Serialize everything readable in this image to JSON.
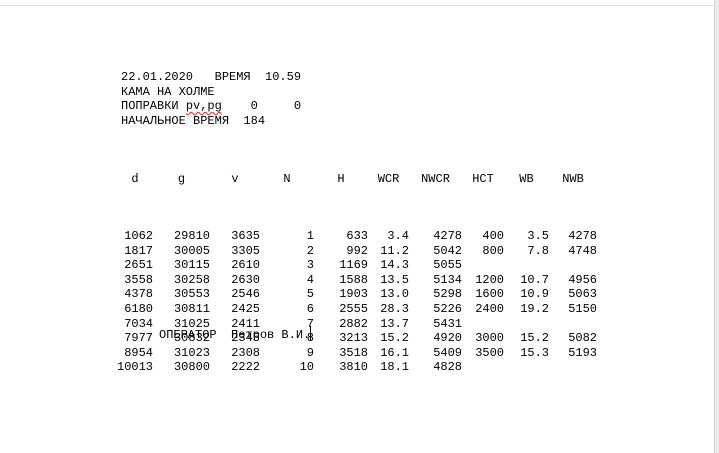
{
  "header": {
    "line1": "22.01.2020   ВРЕМЯ  10.59",
    "line2": "КАМА НА ХОЛМЕ",
    "line3_label": "ПОПРАВКИ ",
    "line3_flagged": "pv,pg",
    "line3_values": "    0     0",
    "line4": "НАЧАЛЬНОЕ ВРЕМЯ  184"
  },
  "table": {
    "columns": [
      "d",
      "g",
      "v",
      "N",
      "H",
      "WCR",
      "NWCR",
      "HCT",
      "WB",
      "NWB"
    ],
    "rows": [
      [
        "1062",
        "29810",
        "3635",
        "1",
        "633",
        "3.4",
        "4278",
        "400",
        "3.5",
        "4278"
      ],
      [
        "1817",
        "30005",
        "3305",
        "2",
        "992",
        "11.2",
        "5042",
        "800",
        "7.8",
        "4748"
      ],
      [
        "2651",
        "30115",
        "2610",
        "3",
        "1169",
        "14.3",
        "5055",
        "",
        "",
        ""
      ],
      [
        "3558",
        "30258",
        "2630",
        "4",
        "1588",
        "13.5",
        "5134",
        "1200",
        "10.7",
        "4956"
      ],
      [
        "4378",
        "30553",
        "2546",
        "5",
        "1903",
        "13.0",
        "5298",
        "1600",
        "10.9",
        "5063"
      ],
      [
        "6180",
        "30811",
        "2425",
        "6",
        "2555",
        "28.3",
        "5226",
        "2400",
        "19.2",
        "5150"
      ],
      [
        "7034",
        "31025",
        "2411",
        "7",
        "2882",
        "13.7",
        "5431",
        "",
        "",
        ""
      ],
      [
        "7977",
        "30832",
        "2345",
        "8",
        "3213",
        "15.2",
        "4920",
        "3000",
        "15.2",
        "5082"
      ],
      [
        "8954",
        "31023",
        "2308",
        "9",
        "3518",
        "16.1",
        "5409",
        "3500",
        "15.3",
        "5193"
      ],
      [
        "10013",
        "30800",
        "2222",
        "10",
        "3810",
        "18.1",
        "4828",
        "",
        "",
        ""
      ]
    ]
  },
  "footer": {
    "text": "ОПЕРАТОР  Петров В.И."
  }
}
